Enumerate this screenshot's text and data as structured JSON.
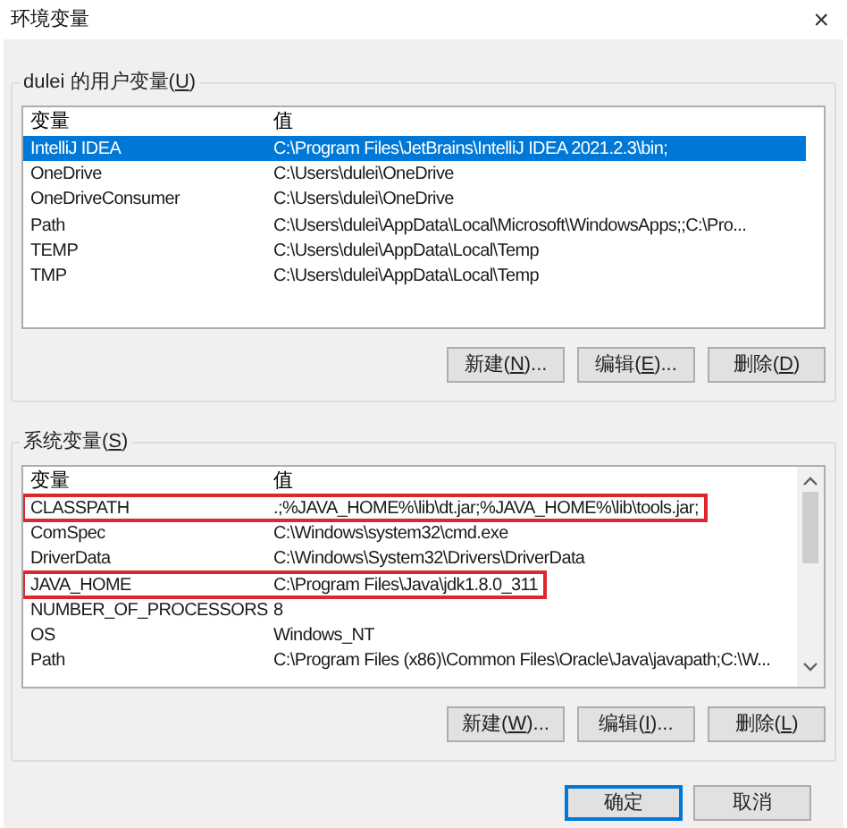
{
  "window": {
    "title": "环境变量",
    "close": "×"
  },
  "user_vars": {
    "label": "dulei 的用户变量(U)",
    "columns": [
      "变量",
      "值"
    ],
    "rows": [
      {
        "name": "IntelliJ IDEA",
        "value": "C:\\Program Files\\JetBrains\\IntelliJ IDEA 2021.2.3\\bin;",
        "selected": true,
        "highlighted": false
      },
      {
        "name": "OneDrive",
        "value": "C:\\Users\\dulei\\OneDrive",
        "selected": false,
        "highlighted": false
      },
      {
        "name": "OneDriveConsumer",
        "value": "C:\\Users\\dulei\\OneDrive",
        "selected": false,
        "highlighted": false
      },
      {
        "name": "Path",
        "value": "C:\\Users\\dulei\\AppData\\Local\\Microsoft\\WindowsApps;;C:\\Pro...",
        "selected": false,
        "highlighted": false
      },
      {
        "name": "TEMP",
        "value": "C:\\Users\\dulei\\AppData\\Local\\Temp",
        "selected": false,
        "highlighted": false
      },
      {
        "name": "TMP",
        "value": "C:\\Users\\dulei\\AppData\\Local\\Temp",
        "selected": false,
        "highlighted": false
      }
    ],
    "buttons": [
      {
        "label": "新建(N)..."
      },
      {
        "label": "编辑(E)..."
      },
      {
        "label": "删除(D)"
      }
    ]
  },
  "system_vars": {
    "label": "系统变量(S)",
    "columns": [
      "变量",
      "值"
    ],
    "rows": [
      {
        "name": "CLASSPATH",
        "value": ".;%JAVA_HOME%\\lib\\dt.jar;%JAVA_HOME%\\lib\\tools.jar;",
        "selected": false,
        "highlighted": true
      },
      {
        "name": "ComSpec",
        "value": "C:\\Windows\\system32\\cmd.exe",
        "selected": false,
        "highlighted": false
      },
      {
        "name": "DriverData",
        "value": "C:\\Windows\\System32\\Drivers\\DriverData",
        "selected": false,
        "highlighted": false
      },
      {
        "name": "JAVA_HOME",
        "value": "C:\\Program Files\\Java\\jdk1.8.0_311",
        "selected": false,
        "highlighted": true
      },
      {
        "name": "NUMBER_OF_PROCESSORS",
        "value": "8",
        "selected": false,
        "highlighted": false
      },
      {
        "name": "OS",
        "value": "Windows_NT",
        "selected": false,
        "highlighted": false
      },
      {
        "name": "Path",
        "value": "C:\\Program Files (x86)\\Common Files\\Oracle\\Java\\javapath;C:\\W...",
        "selected": false,
        "highlighted": false
      }
    ],
    "buttons": [
      {
        "label": "新建(W)..."
      },
      {
        "label": "编辑(I)..."
      },
      {
        "label": "删除(L)"
      }
    ]
  },
  "footer_buttons": [
    {
      "label": "确定",
      "default": true
    },
    {
      "label": "取消",
      "default": false
    }
  ]
}
